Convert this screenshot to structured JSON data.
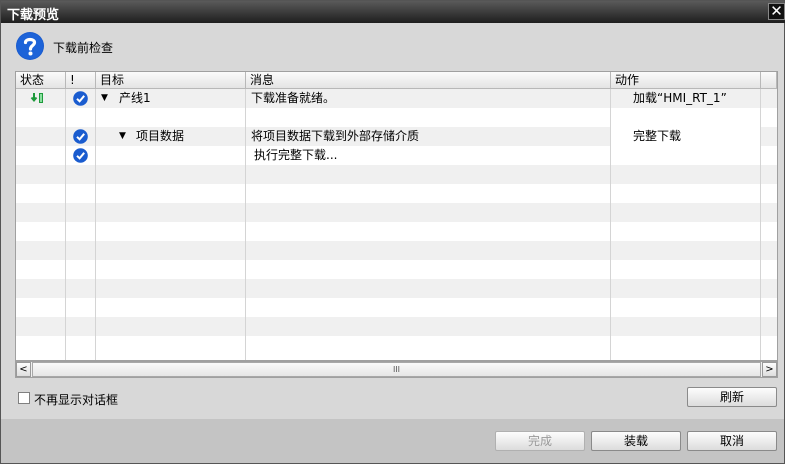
{
  "window": {
    "title": "下载预览",
    "close_label": "✕"
  },
  "header": {
    "title": "下载前检查",
    "icon": "question-icon"
  },
  "table": {
    "columns": [
      "状态",
      "!",
      "目标",
      "消息",
      "动作"
    ],
    "rows": [
      {
        "status_icon": "download-status-icon",
        "checked": true,
        "target": "产线1",
        "expander": "▼",
        "message": "下载准备就绪。",
        "action": "加载“HMI_RT_1”"
      },
      {
        "status_icon": "",
        "checked": false,
        "target": "",
        "expander": "",
        "message": "",
        "action": ""
      },
      {
        "status_icon": "",
        "checked": true,
        "target": "项目数据",
        "expander": "▼",
        "message": "将项目数据下载到外部存储介质",
        "action": "完整下载"
      },
      {
        "status_icon": "",
        "checked": true,
        "target": "",
        "expander": "",
        "message": "执行完整下载...",
        "action": ""
      }
    ]
  },
  "scrollbar": {
    "left": "<",
    "right": ">",
    "thumb": "III"
  },
  "options": {
    "dont_show_again": "不再显示对话框"
  },
  "buttons": {
    "refresh": "刷新",
    "finish": "完成",
    "load": "装载",
    "cancel": "取消"
  },
  "colors": {
    "accent": "#1a5ccf",
    "title_bar": "#2a2a2a",
    "status_green": "#1e9a3c"
  }
}
